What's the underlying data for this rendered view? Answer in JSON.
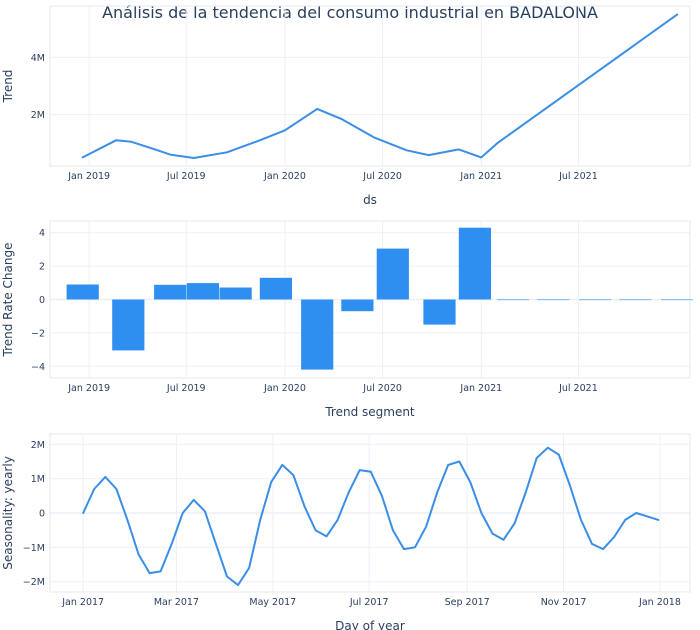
{
  "title": "Análisis de la tendencia del consumo industrial en BADALONA",
  "colors": {
    "line": "#3b8ee6",
    "bar": "#2f8ff0",
    "text": "#2a3f5f",
    "grid": "#ebf0f8"
  },
  "chart_data": [
    {
      "type": "line",
      "xlabel": "ds",
      "ylabel": "Trend",
      "x_axis_type": "date",
      "xlim": [
        "2018-10-20",
        "2022-01-25"
      ],
      "ylim": [
        0.2,
        5.8
      ],
      "y_unit": "M",
      "x_ticks": [
        "2019-01-01",
        "2019-07-01",
        "2020-01-01",
        "2020-07-01",
        "2021-01-01",
        "2021-07-01"
      ],
      "x_tick_labels": [
        "Jan 2019",
        "Jul 2019",
        "Jan 2020",
        "Jul 2020",
        "Jan 2021",
        "Jul 2021"
      ],
      "y_ticks": [
        2,
        4
      ],
      "y_tick_labels": [
        "2M",
        "4M"
      ],
      "grid": true,
      "x": [
        "2018-12-20",
        "2019-02-20",
        "2019-03-20",
        "2019-05-01",
        "2019-06-01",
        "2019-07-15",
        "2019-09-15",
        "2019-11-15",
        "2020-01-01",
        "2020-03-01",
        "2020-04-15",
        "2020-06-15",
        "2020-08-15",
        "2020-09-25",
        "2020-11-20",
        "2021-01-01",
        "2021-01-31",
        "2022-01-01"
      ],
      "y": [
        0.5,
        1.1,
        1.05,
        0.8,
        0.6,
        0.48,
        0.68,
        1.1,
        1.45,
        2.2,
        1.85,
        1.2,
        0.75,
        0.58,
        0.78,
        0.5,
        1.0,
        5.5
      ]
    },
    {
      "type": "bar",
      "xlabel": "Trend segment",
      "ylabel": "Trend Rate Change",
      "x_axis_type": "date",
      "xlim": [
        "2018-10-20",
        "2022-01-25"
      ],
      "ylim": [
        -4.7,
        4.7
      ],
      "x_ticks": [
        "2019-01-01",
        "2019-07-01",
        "2020-01-01",
        "2020-07-01",
        "2021-01-01",
        "2021-07-01"
      ],
      "x_tick_labels": [
        "Jan 2019",
        "Jul 2019",
        "Jan 2020",
        "Jul 2020",
        "Jan 2021",
        "Jul 2021"
      ],
      "y_ticks": [
        -4,
        -2,
        0,
        2,
        4
      ],
      "y_tick_labels": [
        "−4",
        "−2",
        "0",
        "2",
        "4"
      ],
      "grid": true,
      "x": [
        "2018-12-20",
        "2019-03-15",
        "2019-06-01",
        "2019-08-01",
        "2019-10-01",
        "2019-12-15",
        "2020-03-01",
        "2020-05-15",
        "2020-07-20",
        "2020-10-15",
        "2020-12-20",
        "2021-03-01",
        "2021-05-15",
        "2021-08-01",
        "2021-10-15",
        "2022-01-01"
      ],
      "values": [
        0.9,
        -3.05,
        0.88,
        0.98,
        0.72,
        1.3,
        -4.2,
        -0.7,
        3.05,
        -1.5,
        4.3,
        0,
        0,
        0,
        0,
        0
      ],
      "bar_width_days": 60
    },
    {
      "type": "line",
      "xlabel": "Day of year",
      "ylabel": "Seasonality: yearly",
      "x_axis_type": "date",
      "xlim": [
        "2016-12-11",
        "2018-01-20"
      ],
      "ylim": [
        -2.3,
        2.3
      ],
      "y_unit": "M",
      "x_ticks": [
        "2017-01-01",
        "2017-03-01",
        "2017-05-01",
        "2017-07-01",
        "2017-09-01",
        "2017-11-01",
        "2018-01-01"
      ],
      "x_tick_labels": [
        "Jan 2017",
        "Mar 2017",
        "May 2017",
        "Jul 2017",
        "Sep 2017",
        "Nov 2017",
        "Jan 2018"
      ],
      "y_ticks": [
        -2,
        -1,
        0,
        1,
        2
      ],
      "y_tick_labels": [
        "−2M",
        "−1M",
        "0",
        "1M",
        "2M"
      ],
      "grid": true,
      "x": [
        "2017-01-01",
        "2017-01-08",
        "2017-01-15",
        "2017-01-22",
        "2017-01-29",
        "2017-02-05",
        "2017-02-12",
        "2017-02-19",
        "2017-02-26",
        "2017-03-05",
        "2017-03-12",
        "2017-03-19",
        "2017-03-26",
        "2017-04-02",
        "2017-04-09",
        "2017-04-16",
        "2017-04-23",
        "2017-04-30",
        "2017-05-07",
        "2017-05-14",
        "2017-05-21",
        "2017-05-28",
        "2017-06-04",
        "2017-06-11",
        "2017-06-18",
        "2017-06-25",
        "2017-07-02",
        "2017-07-09",
        "2017-07-16",
        "2017-07-23",
        "2017-07-30",
        "2017-08-06",
        "2017-08-13",
        "2017-08-20",
        "2017-08-27",
        "2017-09-03",
        "2017-09-10",
        "2017-09-17",
        "2017-09-24",
        "2017-10-01",
        "2017-10-08",
        "2017-10-15",
        "2017-10-22",
        "2017-10-29",
        "2017-11-05",
        "2017-11-12",
        "2017-11-19",
        "2017-11-26",
        "2017-12-03",
        "2017-12-10",
        "2017-12-17",
        "2017-12-24",
        "2017-12-31"
      ],
      "y": [
        0.0,
        0.7,
        1.05,
        0.7,
        -0.2,
        -1.2,
        -1.75,
        -1.7,
        -0.9,
        0.0,
        0.38,
        0.05,
        -0.9,
        -1.85,
        -2.1,
        -1.6,
        -0.2,
        0.9,
        1.4,
        1.1,
        0.2,
        -0.5,
        -0.68,
        -0.2,
        0.6,
        1.25,
        1.2,
        0.5,
        -0.5,
        -1.05,
        -1.0,
        -0.4,
        0.6,
        1.4,
        1.5,
        0.9,
        0.0,
        -0.6,
        -0.78,
        -0.3,
        0.6,
        1.6,
        1.9,
        1.7,
        0.8,
        -0.2,
        -0.9,
        -1.05,
        -0.7,
        -0.2,
        0.0,
        -0.1,
        -0.2
      ]
    }
  ]
}
